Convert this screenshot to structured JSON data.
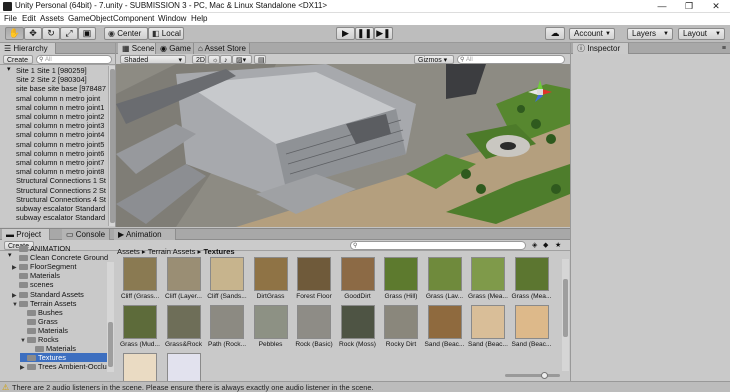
{
  "window": {
    "title": "Unity Personal (64bit) - 7.unity - SUBMISSION 3 - PC, Mac & Linux Standalone <DX11>",
    "minimize": "—",
    "restore": "❐",
    "close": "✕"
  },
  "menu": [
    "File",
    "Edit",
    "Assets",
    "GameObject",
    "Component",
    "Window",
    "Help"
  ],
  "toolbar": {
    "pivot_center": "Center",
    "pivot_local": "Local",
    "account": "Account",
    "layers": "Layers",
    "layout": "Layout"
  },
  "hierarchy": {
    "tab": "Hierarchy",
    "create": "Create",
    "search_placeholder": "All",
    "items": [
      "Site 1 Site 1 [980259]",
      "Site 2 Site 2 [980304]",
      "site base site base [978487",
      "smal column n metro joint",
      "smal column n metro joint1",
      "smal column n metro joint2",
      "smal column n metro joint3",
      "smal column n metro joint4",
      "smal column n metro joint5",
      "smal column n metro joint6",
      "smal column n metro joint7",
      "smal column n metro joint8",
      "Structural Connections 1 St",
      "Structural Connections 2 St",
      "Structural Connections 4 St",
      "subway escalator Standard",
      "subway escalator Standard"
    ]
  },
  "scene": {
    "tabs": [
      "Scene",
      "Game",
      "Asset Store"
    ],
    "shading": "Shaded",
    "mode_2d": "2D",
    "gizmos": "Gizmos",
    "search_placeholder": "All",
    "colors": {
      "ground": "#b49f7e",
      "grass": "#4e7d2c",
      "building": "#a7a9ad",
      "sky": "#c8c8c8"
    }
  },
  "inspector": {
    "tab": "Inspector"
  },
  "project": {
    "tabs": [
      "Project",
      "Console",
      "Animation"
    ],
    "create": "Create",
    "breadcrumb": [
      "Assets",
      "Terrain Assets",
      "Textures"
    ],
    "tree": [
      {
        "label": "ANIMATION",
        "depth": 1,
        "expand": ""
      },
      {
        "label": "Clean Concrete Ground",
        "depth": 1,
        "expand": ""
      },
      {
        "label": "FloorSegment",
        "depth": 1,
        "expand": "▶"
      },
      {
        "label": "Materials",
        "depth": 1,
        "expand": ""
      },
      {
        "label": "scenes",
        "depth": 1,
        "expand": ""
      },
      {
        "label": "Standard Assets",
        "depth": 1,
        "expand": "▶"
      },
      {
        "label": "Terrain Assets",
        "depth": 1,
        "expand": "▼"
      },
      {
        "label": "Bushes",
        "depth": 2,
        "expand": ""
      },
      {
        "label": "Grass",
        "depth": 2,
        "expand": ""
      },
      {
        "label": "Materials",
        "depth": 2,
        "expand": ""
      },
      {
        "label": "Rocks",
        "depth": 2,
        "expand": "▼"
      },
      {
        "label": "Materials",
        "depth": 3,
        "expand": ""
      },
      {
        "label": "Textures",
        "depth": 2,
        "expand": "",
        "selected": true
      },
      {
        "label": "Trees Ambient-Occlus",
        "depth": 2,
        "expand": "▶"
      }
    ],
    "assets": [
      {
        "label": "Cliff (Grass...",
        "color": "#8a7a52"
      },
      {
        "label": "Cliff (Layer...",
        "color": "#9a8e74"
      },
      {
        "label": "Cliff (Sands...",
        "color": "#c7b48d"
      },
      {
        "label": "DirtGrass",
        "color": "#8f7345"
      },
      {
        "label": "Forest Floor",
        "color": "#6f5a3a"
      },
      {
        "label": "GoodDirt",
        "color": "#8c6a45"
      },
      {
        "label": "Grass (Hill)",
        "color": "#5d7a2e"
      },
      {
        "label": "Grass (Lav...",
        "color": "#6f8a3c"
      },
      {
        "label": "Grass (Mea...",
        "color": "#7f9a4a"
      },
      {
        "label": "Grass (Mea...",
        "color": "#5c7630"
      },
      {
        "label": "Grass (Mud...",
        "color": "#5d6b3a"
      },
      {
        "label": "Grass&Rock",
        "color": "#6e6e58"
      },
      {
        "label": "Path (Rock...",
        "color": "#8c8a82"
      },
      {
        "label": "Pebbles",
        "color": "#8d9184"
      },
      {
        "label": "Rock (Basic)",
        "color": "#8e8c86"
      },
      {
        "label": "Rock (Moss)",
        "color": "#4e5444"
      },
      {
        "label": "Rocky Dirt",
        "color": "#8a877c"
      },
      {
        "label": "Sand (Beac...",
        "color": "#8f6a3e"
      },
      {
        "label": "Sand (Beac...",
        "color": "#d9be98"
      },
      {
        "label": "Sand (Beac...",
        "color": "#ddb98a"
      },
      {
        "label": "",
        "color": "#eadbc3"
      },
      {
        "label": "",
        "color": "#e2e2ee"
      }
    ]
  },
  "status": {
    "message": "There are 2 audio listeners in the scene. Please ensure there is always exactly one audio listener in the scene."
  }
}
